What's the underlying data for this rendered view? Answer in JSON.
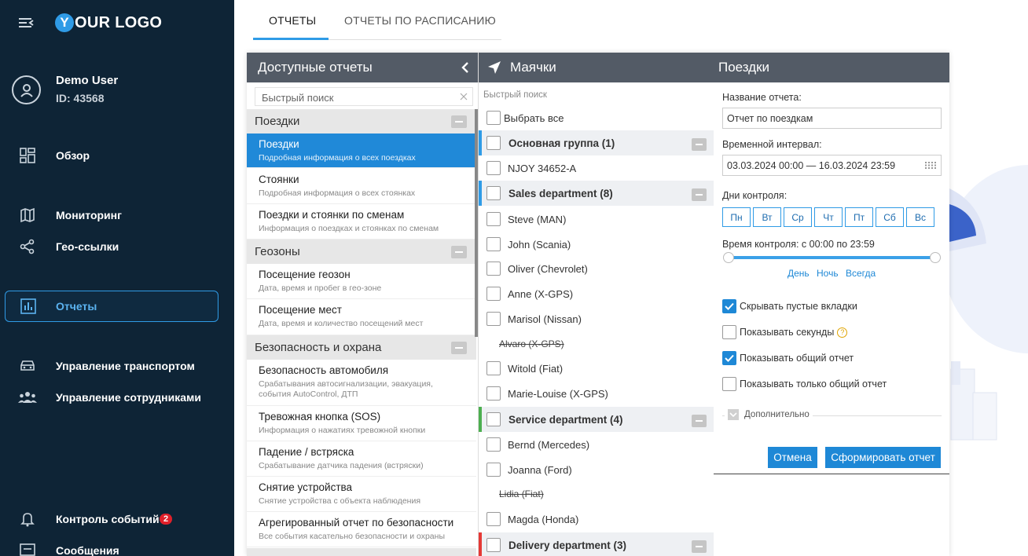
{
  "sidebar": {
    "logo_letter": "Y",
    "logo_text": "OUR LOGO",
    "user_name": "Demo User",
    "user_id": "ID: 43568",
    "nav": {
      "overview": "Обзор",
      "monitoring": "Мониторинг",
      "geolinks": "Гео-ссылки",
      "reports": "Отчеты",
      "transport": "Управление транспортом",
      "staff": "Управление сотрудниками",
      "events": "Контроль событий",
      "events_badge": "2",
      "messages": "Сообщения"
    }
  },
  "tabs": [
    "ОТЧЕТЫ",
    "ОТЧЕТЫ ПО РАСПИСАНИЮ"
  ],
  "reports_panel": {
    "title": "Доступные отчеты",
    "search_placeholder": "Быстрый поиск",
    "categories": [
      "Поездки",
      "Геозоны",
      "Безопасность и охрана"
    ],
    "items": [
      {
        "title": "Поездки",
        "desc": "Подробная информация о всех поездках"
      },
      {
        "title": "Стоянки",
        "desc": "Подробная информация о всех стоянках"
      },
      {
        "title": "Поездки и стоянки по сменам",
        "desc": "Информация о поездках и стоянках по сменам"
      },
      {
        "title": "Посещение геозон",
        "desc": "Дата, время и пробег в гео-зоне"
      },
      {
        "title": "Посещение мест",
        "desc": "Дата, время и количество посещений мест"
      },
      {
        "title": "Безопасность автомобиля",
        "desc": "Срабатывания автосигнализации, эвакуация, события AutoControl, ДТП"
      },
      {
        "title": "Тревожная кнопка (SOS)",
        "desc": "Информация о нажатиях тревожной кнопки"
      },
      {
        "title": "Падение / встряска",
        "desc": "Срабатывание датчика падения (встряски)"
      },
      {
        "title": "Снятие устройства",
        "desc": "Снятие устройства с объекта наблюдения"
      },
      {
        "title": "Агрегированный отчет по безопасности",
        "desc": "Все события касательно безопасности и охраны"
      }
    ]
  },
  "trackers_panel": {
    "title": "Маячки",
    "search_placeholder": "Быстрый поиск",
    "select_all": "Выбрать все",
    "groups": [
      {
        "name": "Основная группа (1)",
        "color": "#2f9be6"
      },
      {
        "name": "Sales department (8)",
        "color": "#2f9be6"
      },
      {
        "name": "Service department (4)",
        "color": "#4caf50"
      },
      {
        "name": "Delivery department (3)",
        "color": "#e53935"
      }
    ],
    "items": [
      "NJOY 34652-A",
      "Steve (MAN)",
      "John (Scania)",
      "Oliver (Chevrolet)",
      "Anne (X-GPS)",
      "Marisol (Nissan)",
      "Alvaro (X-GPS)",
      "Witold (Fiat)",
      "Marie-Louise (X-GPS)",
      "Bernd (Mercedes)",
      "Joanna (Ford)",
      "Lidia (Fiat)",
      "Magda (Honda)"
    ]
  },
  "trip_panel": {
    "title": "Поездки",
    "name_label": "Название отчета:",
    "name_value": "Отчет по поездкам",
    "interval_label": "Временной интервал:",
    "interval_value": "03.03.2024 00:00 — 16.03.2024 23:59",
    "days_label": "Дни контроля:",
    "days": [
      "Пн",
      "Вт",
      "Ср",
      "Чт",
      "Пт",
      "Сб",
      "Вс"
    ],
    "time_label": "Время контроля: с 00:00 по 23:59",
    "presets": [
      "День",
      "Ночь",
      "Всегда"
    ],
    "checkboxes": [
      {
        "label": "Скрывать пустые вкладки",
        "checked": true
      },
      {
        "label": "Показывать секунды",
        "checked": false
      },
      {
        "label": "Показывать общий отчет",
        "checked": true
      },
      {
        "label": "Показывать только общий отчет",
        "checked": false
      }
    ],
    "additional": "Дополнительно",
    "cancel": "Отмена",
    "generate": "Сформировать отчет"
  },
  "colors": {
    "accent": "#2f9be6",
    "sidebar_bg": "#0e2436",
    "header_bg": "#535b66"
  }
}
